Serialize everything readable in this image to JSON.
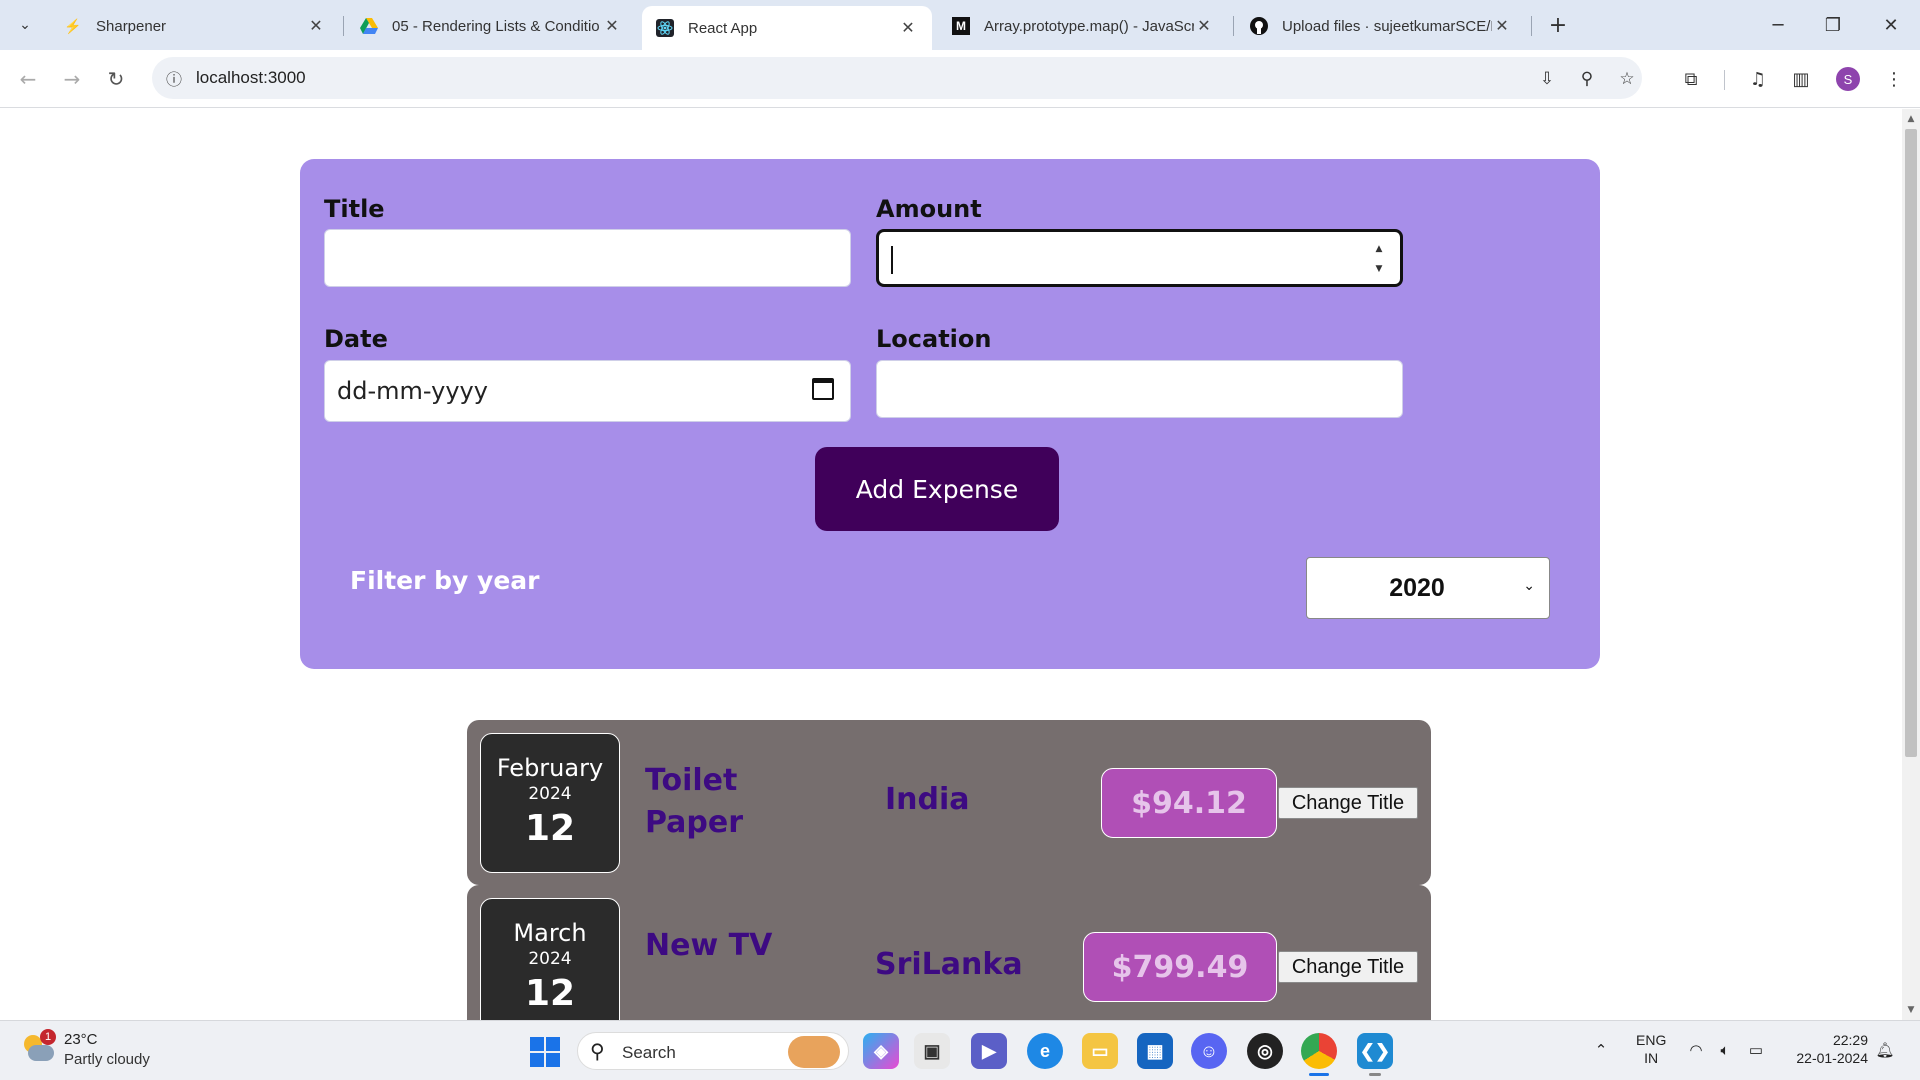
{
  "browser": {
    "tabs": [
      {
        "title": "Sharpener",
        "icon": "sharpener-icon"
      },
      {
        "title": "05 - Rendering Lists & Conditio",
        "icon": "google-drive-icon"
      },
      {
        "title": "React App",
        "icon": "react-icon"
      },
      {
        "title": "Array.prototype.map() - JavaScr",
        "icon": "mdn-icon"
      },
      {
        "title": "Upload files · sujeetkumarSCE/F",
        "icon": "github-icon"
      }
    ],
    "active_tab": 2,
    "url": "localhost:3000",
    "profile_initial": "S"
  },
  "form": {
    "title_label": "Title",
    "amount_label": "Amount",
    "date_label": "Date",
    "date_placeholder": "dd-mm-yyyy",
    "location_label": "Location",
    "add_button": "Add Expense",
    "filter_label": "Filter by year",
    "filter_value": "2020"
  },
  "expenses": [
    {
      "month": "February",
      "year": "2024",
      "day": "12",
      "title_line1": "Toilet",
      "title_line2": "Paper",
      "location": "India",
      "amount": "$94.12",
      "change_button": "Change Title"
    },
    {
      "month": "March",
      "year": "2024",
      "day": "12",
      "title_line1": "New TV",
      "title_line2": "",
      "location": "SriLanka",
      "amount": "$799.49",
      "change_button": "Change Title"
    }
  ],
  "colors": {
    "form_bg": "#a78ee9",
    "button_bg": "#40005a",
    "item_bg": "#766e6e",
    "amount_bg": "#b04fb6",
    "title_text": "#3d0a82"
  },
  "taskbar": {
    "weather_temp": "23°C",
    "weather_desc": "Partly cloudy",
    "weather_badge": "1",
    "search_placeholder": "Search",
    "lang_line1": "ENG",
    "lang_line2": "IN",
    "time": "22:29",
    "date": "22-01-2024"
  }
}
